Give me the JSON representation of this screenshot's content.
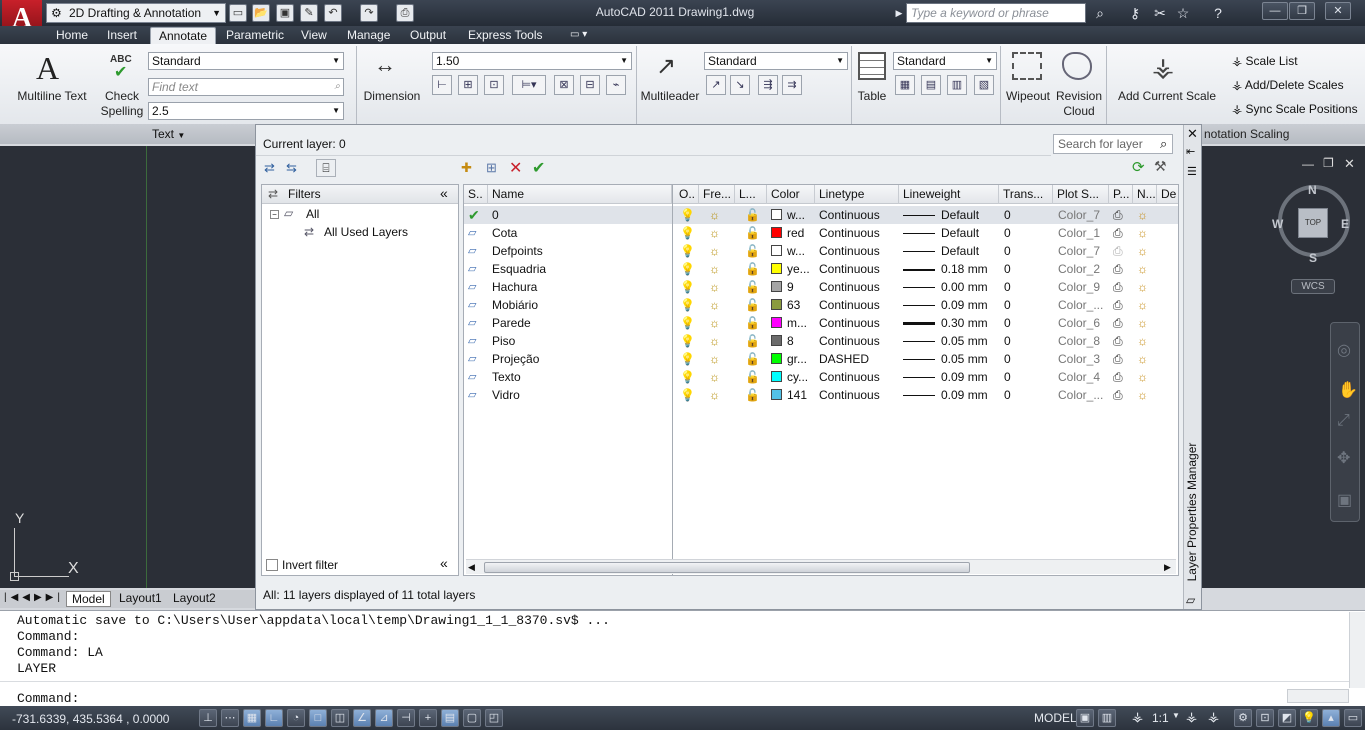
{
  "app": {
    "title": "AutoCAD 2011    Drawing1.dwg",
    "logo_letter": "A"
  },
  "workspace": {
    "value": "2D Drafting & Annotation"
  },
  "keyword_search": {
    "placeholder": "Type a keyword or phrase"
  },
  "ribbon_tabs": [
    "Home",
    "Insert",
    "Annotate",
    "Parametric",
    "View",
    "Manage",
    "Output",
    "Express Tools"
  ],
  "ribbon": {
    "multiline_text": "Multiline Text",
    "check_spelling": "Check Spelling",
    "check_spelling_abc": "ABC",
    "text_style": "Standard",
    "find_text": "Find text",
    "text_height": "2.5",
    "dimension": "Dimension",
    "dim_scale": "1.50",
    "multileader": "Multileader",
    "mleader_style": "Standard",
    "table": "Table",
    "table_style": "Standard",
    "wipeout": "Wipeout",
    "revision_cloud": "Revision Cloud",
    "add_current_scale": "Add Current Scale",
    "scale_list": "Scale List",
    "add_delete_scales": "Add/Delete Scales",
    "sync_scale_positions": "Sync Scale Positions",
    "panel_text": "Text",
    "panel_annotation_scaling": "notation Scaling"
  },
  "layer_manager": {
    "current_layer": "Current layer: 0",
    "search_placeholder": "Search for layer",
    "filters_title": "Filters",
    "filter_all": "All",
    "filter_used": "All Used Layers",
    "invert_filter": "Invert filter",
    "status": "All: 11 layers displayed of 11 total layers",
    "side_title": "Layer Properties Manager",
    "columns": [
      "S..",
      "Name",
      "O..",
      "Fre...",
      "L...",
      "Color",
      "Linetype",
      "Lineweight",
      "Trans...",
      "Plot S...",
      "P...",
      "N...",
      "De"
    ],
    "layers": [
      {
        "name": "0",
        "color_name": "w...",
        "color": "#ffffff",
        "linetype": "Continuous",
        "lineweight": "Default",
        "trans": "0",
        "plot_style": "Color_7",
        "current": true
      },
      {
        "name": "Cota",
        "color_name": "red",
        "color": "#ff0000",
        "linetype": "Continuous",
        "lineweight": "Default",
        "trans": "0",
        "plot_style": "Color_1",
        "current": false
      },
      {
        "name": "Defpoints",
        "color_name": "w...",
        "color": "#ffffff",
        "linetype": "Continuous",
        "lineweight": "Default",
        "trans": "0",
        "plot_style": "Color_7",
        "current": false
      },
      {
        "name": "Esquadria",
        "color_name": "ye...",
        "color": "#ffff00",
        "linetype": "Continuous",
        "lineweight": "0.18 mm",
        "trans": "0",
        "plot_style": "Color_2",
        "current": false
      },
      {
        "name": "Hachura",
        "color_name": "9",
        "color": "#a5a5a5",
        "linetype": "Continuous",
        "lineweight": "0.00 mm",
        "trans": "0",
        "plot_style": "Color_9",
        "current": false
      },
      {
        "name": "Mobiário",
        "color_name": "63",
        "color": "#8a9b3f",
        "linetype": "Continuous",
        "lineweight": "0.09 mm",
        "trans": "0",
        "plot_style": "Color_...",
        "current": false
      },
      {
        "name": "Parede",
        "color_name": "m...",
        "color": "#ff00ff",
        "linetype": "Continuous",
        "lineweight": "0.30 mm",
        "trans": "0",
        "plot_style": "Color_6",
        "current": false
      },
      {
        "name": "Piso",
        "color_name": "8",
        "color": "#6b6b6b",
        "linetype": "Continuous",
        "lineweight": "0.05 mm",
        "trans": "0",
        "plot_style": "Color_8",
        "current": false
      },
      {
        "name": "Projeção",
        "color_name": "gr...",
        "color": "#00ff00",
        "linetype": "DASHED",
        "lineweight": "0.05 mm",
        "trans": "0",
        "plot_style": "Color_3",
        "current": false
      },
      {
        "name": "Texto",
        "color_name": "cy...",
        "color": "#00ffff",
        "linetype": "Continuous",
        "lineweight": "0.09 mm",
        "trans": "0",
        "plot_style": "Color_4",
        "current": false
      },
      {
        "name": "Vidro",
        "color_name": "141",
        "color": "#52c1e6",
        "linetype": "Continuous",
        "lineweight": "0.09 mm",
        "trans": "0",
        "plot_style": "Color_...",
        "current": false
      }
    ]
  },
  "layout_tabs": [
    "Model",
    "Layout1",
    "Layout2"
  ],
  "command_history": "Automatic save to C:\\Users\\User\\appdata\\local\\temp\\Drawing1_1_1_8370.sv$ ...\nCommand:\nCommand: LA\nLAYER",
  "command_prompt": "Command:",
  "status": {
    "coords": "-731.6339, 435.5364 , 0.0000",
    "model": "MODEL",
    "scale": "1:1"
  },
  "viewcube": {
    "n": "N",
    "s": "S",
    "e": "E",
    "w": "W",
    "top": "TOP",
    "wcs": "WCS"
  },
  "ucs": {
    "x": "X",
    "y": "Y"
  }
}
